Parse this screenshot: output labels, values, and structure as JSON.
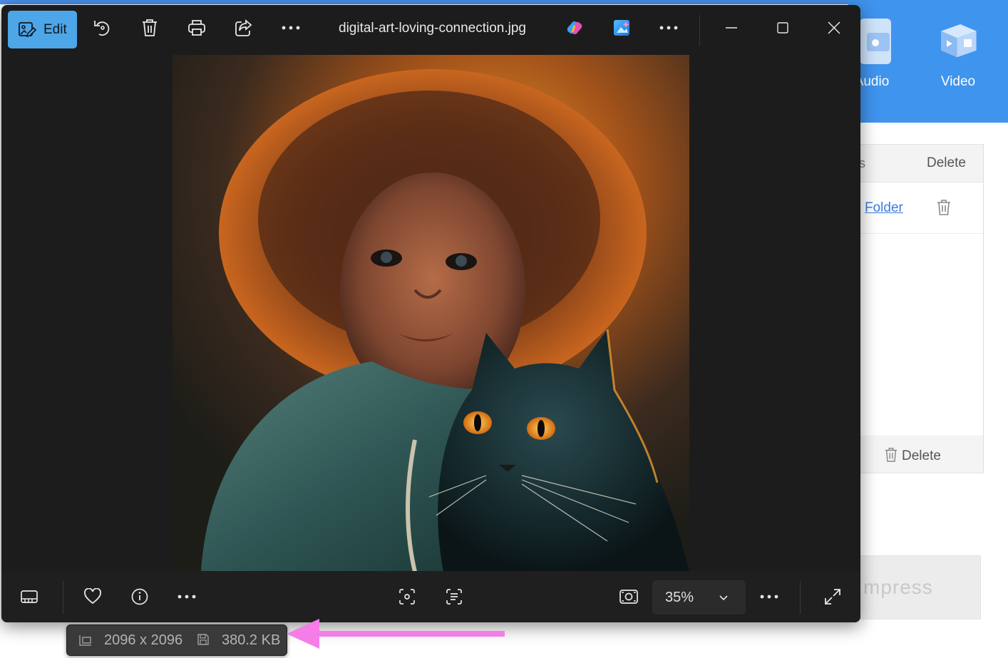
{
  "background_app": {
    "nav": [
      {
        "label": "Audio",
        "icon": "audio-folder-icon"
      },
      {
        "label": "Video",
        "icon": "video-icon"
      }
    ],
    "table": {
      "col_partial": "s",
      "col_delete": "Delete",
      "row_link": "Folder",
      "row_delete_icon": "trash-icon"
    },
    "footer_delete": "Delete",
    "compress_partial": "mpress"
  },
  "viewer": {
    "edit_label": "Edit",
    "filename": "digital-art-loving-connection.jpg",
    "toolbar_icons": [
      "edit-icon",
      "rotate-icon",
      "delete-icon",
      "print-icon",
      "share-icon",
      "more-icon",
      "copilot-icon",
      "designer-icon",
      "more-icon",
      "minimize-icon",
      "maximize-icon",
      "close-icon"
    ],
    "bottom_icons": [
      "filmstrip-icon",
      "favorite-icon",
      "info-icon",
      "more-icon",
      "visual-search-icon",
      "text-scan-icon",
      "fit-to-window-icon",
      "more-icon",
      "fullscreen-icon"
    ],
    "zoom": "35%",
    "image_description_icon": "photo-image",
    "status": {
      "dimensions": "2096 x 2096",
      "file_size": "380.2 KB"
    }
  },
  "colors": {
    "edit_accent": "#4ca6e8",
    "window_bg": "#1c1c1c",
    "header_blue": "#3f94ee",
    "arrow_pink": "#f47de8"
  }
}
